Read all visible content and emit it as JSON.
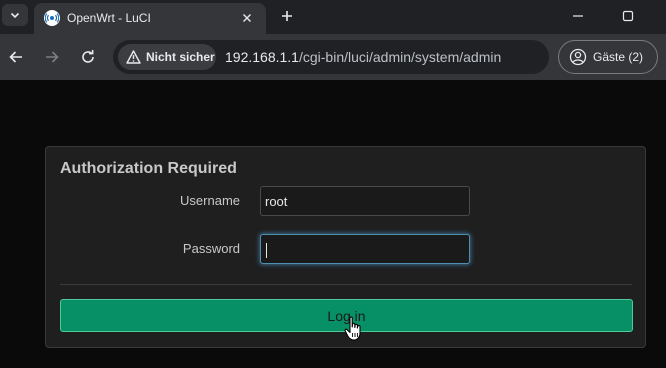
{
  "browser": {
    "tab": {
      "title": "OpenWrt - LuCI",
      "favicon": "openwrt-icon"
    },
    "address_bar": {
      "security_label": "Nicht sicher",
      "url_host": "192.168.1.1",
      "url_path": "/cgi-bin/luci/admin/system/admin"
    },
    "profile_label": "Gäste (2)"
  },
  "login": {
    "title": "Authorization Required",
    "username_label": "Username",
    "username_value": "root",
    "password_label": "Password",
    "password_value": "",
    "submit_label": "Log in"
  },
  "colors": {
    "accent_button": "#079065",
    "focus_ring": "#4e8fb0",
    "page_background": "#0a0a0a"
  }
}
